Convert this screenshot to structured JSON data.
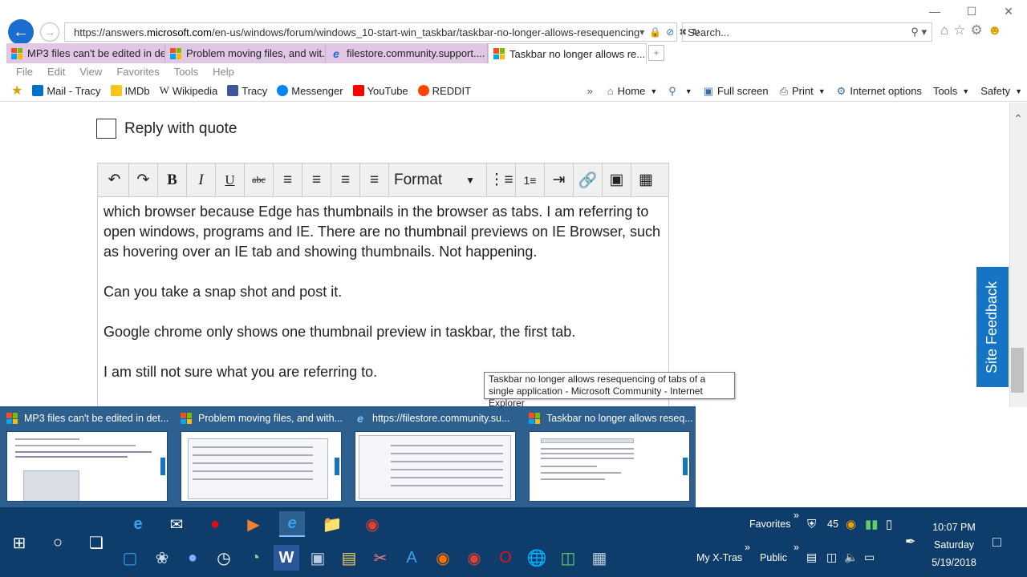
{
  "browser": {
    "url_prefix": "https://answers.",
    "url_domain": "microsoft.com",
    "url_rest": "/en-us/windows/forum/windows_10-start-win_taskbar/taskbar-no-longer-allows-resequencing",
    "search_placeholder": "Search..."
  },
  "tabs": [
    {
      "label": "MP3 files can't be edited in det...",
      "icon": "microsoft-logo"
    },
    {
      "label": "Problem moving files, and wit...",
      "icon": "microsoft-logo"
    },
    {
      "label": "filestore.community.support....",
      "icon": "ie-icon"
    },
    {
      "label": "Taskbar no longer allows re...",
      "icon": "microsoft-logo",
      "active": true
    }
  ],
  "menu": [
    "File",
    "Edit",
    "View",
    "Favorites",
    "Tools",
    "Help"
  ],
  "favorites": [
    {
      "label": "Mail - Tracy",
      "icon": "outlook-icon",
      "color": "#0072c6"
    },
    {
      "label": "IMDb",
      "icon": "imdb-icon",
      "color": "#f5c518"
    },
    {
      "label": "Wikipedia",
      "icon": "wikipedia-icon",
      "color": "#555555"
    },
    {
      "label": "Tracy",
      "icon": "facebook-icon",
      "color": "#3b5998"
    },
    {
      "label": "Messenger",
      "icon": "messenger-icon",
      "color": "#0084ff"
    },
    {
      "label": "YouTube",
      "icon": "youtube-icon",
      "color": "#ff0000"
    },
    {
      "label": "REDDIT",
      "icon": "reddit-icon",
      "color": "#ff4500"
    }
  ],
  "commandbar": {
    "home": "Home",
    "fullscreen": "Full screen",
    "print": "Print",
    "internet_options": "Internet options",
    "tools": "Tools",
    "safety": "Safety"
  },
  "page": {
    "reply_with_quote": "Reply with quote",
    "format_label": "Format",
    "editor_paragraphs": [
      "which browser because Edge has thumbnails in the browser as tabs. I am referring to open windows, programs and IE. There are no thumbnail previews on IE Browser, such as hovering over an IE tab and showing thumbnails. Not happening.",
      "Can you take a snap shot and post it.",
      "Google chrome only shows one thumbnail preview in taskbar, the first tab.",
      "I am still not sure what you are referring to."
    ],
    "site_feedback": "Site Feedback"
  },
  "tooltip": "Taskbar no longer allows resequencing of tabs of a single application - Microsoft Community - Internet Explorer",
  "thumbnails": [
    {
      "title": "MP3 files can't be edited in det...",
      "icon": "microsoft-logo"
    },
    {
      "title": "Problem moving files, and with...",
      "icon": "microsoft-logo"
    },
    {
      "title": "https://filestore.community.su...",
      "icon": "ie-icon"
    },
    {
      "title": "Taskbar no longer allows reseq...",
      "icon": "microsoft-logo"
    }
  ],
  "taskbar": {
    "favorites": "Favorites",
    "tray_number": "45",
    "my_xtras": "My X-Tras",
    "public": "Public",
    "time": "10:07 PM",
    "day": "Saturday",
    "date": "5/19/2018"
  },
  "colors": {
    "accent": "#1c6dd0",
    "tab_inactive": "#e0c8e4",
    "taskbar": "#0e3d6b",
    "thumb_strip": "#2d5f8f",
    "site_feedback": "#1574c4"
  }
}
